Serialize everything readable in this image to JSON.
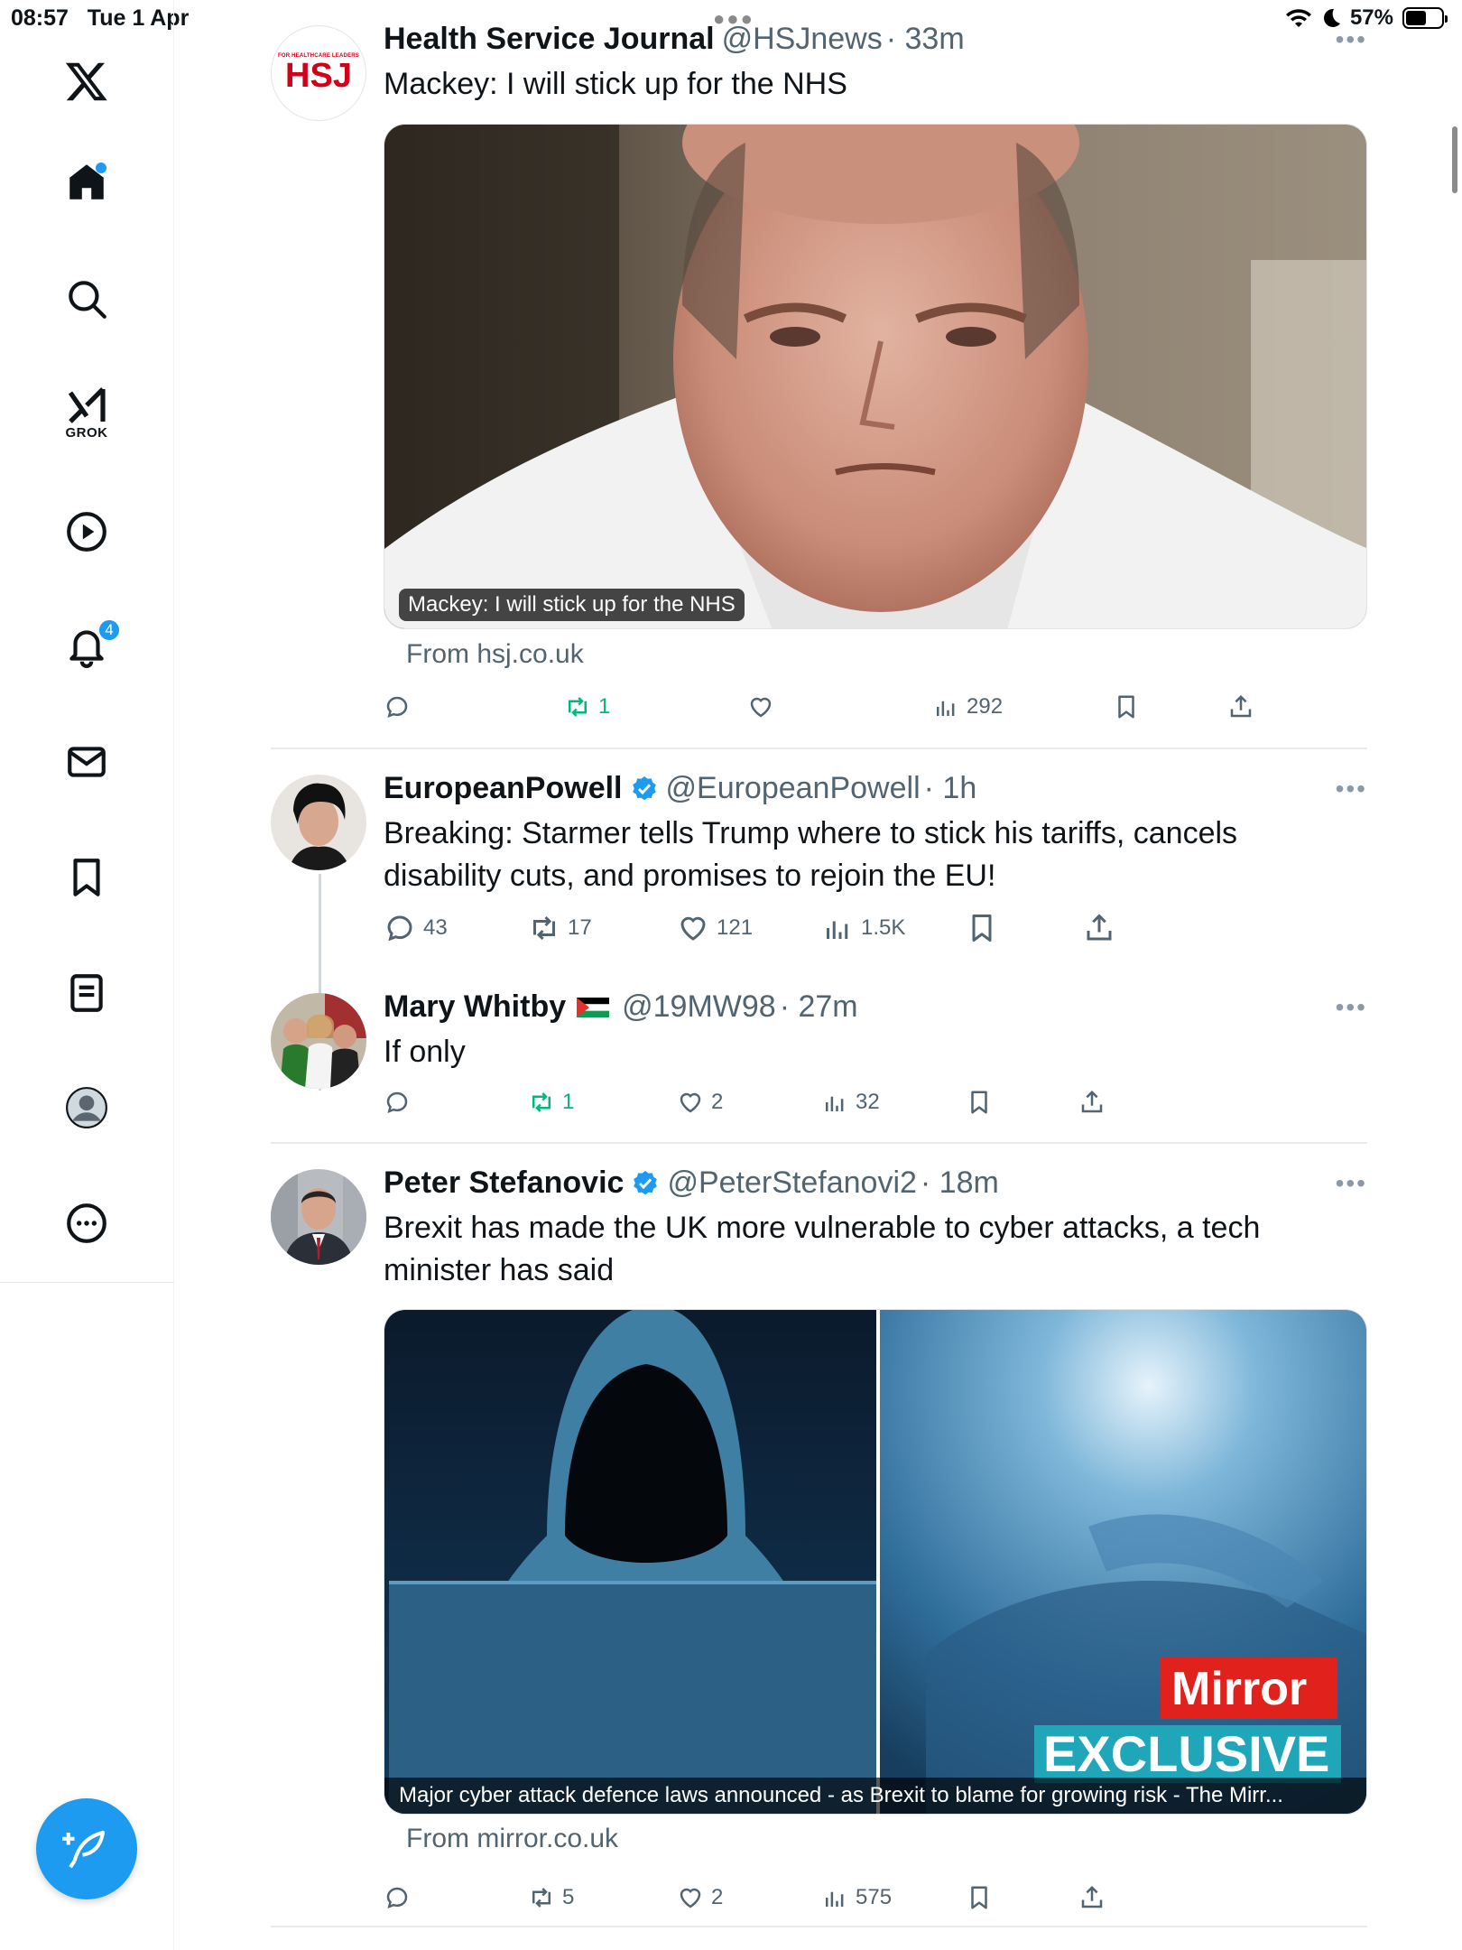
{
  "status_bar": {
    "time": "08:57",
    "date": "Tue 1 Apr",
    "battery": "57%",
    "battery_level": 0.57
  },
  "sidebar": {
    "items": [
      {
        "name": "x-logo-icon"
      },
      {
        "name": "home-icon"
      },
      {
        "name": "search-icon"
      },
      {
        "name": "grok-icon",
        "label": "GROK"
      },
      {
        "name": "video-icon"
      },
      {
        "name": "notifications-icon",
        "badge": "4"
      },
      {
        "name": "messages-icon"
      },
      {
        "name": "bookmarks-icon"
      },
      {
        "name": "lists-icon"
      },
      {
        "name": "profile-icon"
      },
      {
        "name": "more-icon"
      }
    ],
    "compose_icon": "compose-icon"
  },
  "colors": {
    "accent": "#1d9bf0",
    "retweet_active": "#00ba7c",
    "secondary_text": "#536471"
  },
  "posts": [
    {
      "name": "Health Service Journal",
      "handle": "@HSJnews",
      "time": "· 33m",
      "avatar_text_small": "FOR HEALTHCARE LEADERS",
      "avatar_text": "HSJ",
      "text": "Mackey: I will stick up for the NHS",
      "card_caption": "Mackey: I will stick up for the NHS",
      "card_from": "From hsj.co.uk",
      "stats": {
        "replies": "",
        "reposts": "1",
        "likes": "",
        "views": "292"
      }
    },
    {
      "name": "EuropeanPowell",
      "handle": "@EuropeanPowell",
      "time": "· 1h",
      "verified": true,
      "text": "Breaking: Starmer tells Trump where to stick his tariffs, cancels disability cuts, and promises to rejoin the EU!",
      "stats": {
        "replies": "43",
        "reposts": "17",
        "likes": "121",
        "views": "1.5K"
      }
    },
    {
      "name": "Mary Whitby",
      "handle": "@19MW98",
      "time": "· 27m",
      "text": "If only",
      "stats": {
        "replies": "",
        "reposts": "1",
        "likes": "2",
        "views": "32"
      }
    },
    {
      "name": "Peter Stefanovic",
      "handle": "@PeterStefanovi2",
      "time": "· 18m",
      "verified": true,
      "text": "Brexit has made the UK more vulnerable to cyber attacks, a tech minister has said",
      "card_caption": "Major cyber attack defence laws announced - as Brexit to blame for growing risk - The Mirr...",
      "card_brand": "Mirror",
      "card_tag": "EXCLUSIVE",
      "card_from": "From mirror.co.uk",
      "stats": {
        "replies": "",
        "reposts": "5",
        "likes": "2",
        "views": "575"
      }
    }
  ]
}
